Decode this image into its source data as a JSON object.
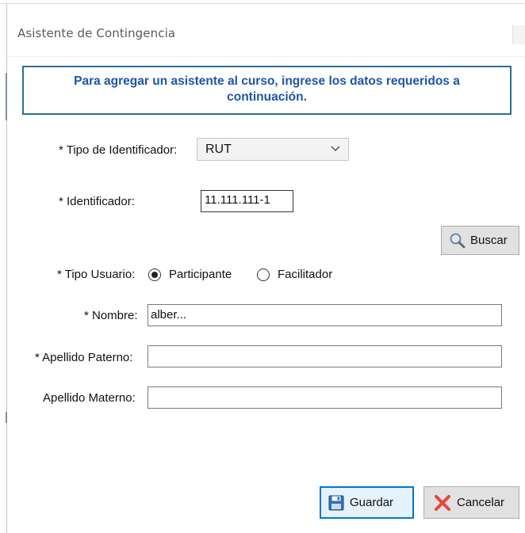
{
  "window": {
    "title": "Asistente de Contingencia"
  },
  "banner": {
    "line1": "Para agregar un asistente al curso, ingrese los datos requeridos a",
    "line2": "continuación."
  },
  "form": {
    "tipo_identificador_label": "* Tipo de Identificador:",
    "tipo_identificador_value": "RUT",
    "identificador_label": "* Identificador:",
    "identificador_value": "11.111.111-1",
    "buscar_label": "Buscar",
    "tipo_usuario_label": "* Tipo Usuario:",
    "tipo_usuario_options": [
      {
        "label": "Participante",
        "selected": true
      },
      {
        "label": "Facilitador",
        "selected": false
      }
    ],
    "nombre_label": "* Nombre:",
    "nombre_value": "alber...",
    "apellido_paterno_label": "* Apellido Paterno:",
    "apellido_paterno_value": "",
    "apellido_materno_label": "Apellido Materno:",
    "apellido_materno_value": ""
  },
  "actions": {
    "guardar_label": "Guardar",
    "cancelar_label": "Cancelar"
  },
  "icons": {
    "buscar": "magnifier-icon",
    "guardar": "floppy-disk-icon",
    "cancelar": "red-x-icon",
    "dropdown": "chevron-down-icon"
  },
  "colors": {
    "banner_border": "#2a6e99",
    "banner_text": "#1f55a3",
    "primary_button_border": "#0078d7",
    "cancel_icon": "#e8453c"
  }
}
